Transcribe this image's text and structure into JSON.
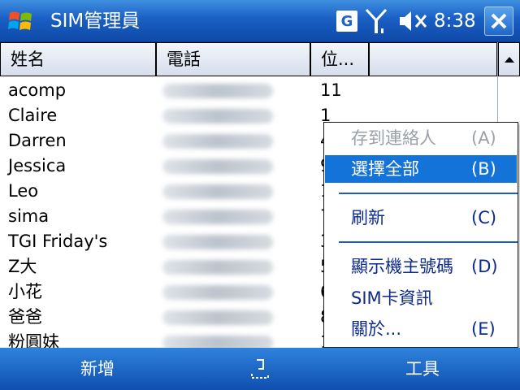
{
  "titlebar": {
    "title": "SIM管理員",
    "clock": "8:38",
    "g_label": "G"
  },
  "columns": {
    "name": "姓名",
    "phone": "電話",
    "location": "位...",
    "extra": ""
  },
  "rows": [
    {
      "name": "acomp",
      "loc": "11"
    },
    {
      "name": "Claire",
      "loc": "1"
    },
    {
      "name": "Darren",
      "loc": "4"
    },
    {
      "name": "Jessica",
      "loc": "9"
    },
    {
      "name": "Leo",
      "loc": "1"
    },
    {
      "name": "sima",
      "loc": "7"
    },
    {
      "name": "TGI Friday's",
      "loc": "3"
    },
    {
      "name": "Z大",
      "loc": "5"
    },
    {
      "name": "小花",
      "loc": "6"
    },
    {
      "name": "爸爸",
      "loc": "8"
    },
    {
      "name": "粉圓妹",
      "loc": "1"
    }
  ],
  "menu": {
    "save_contact": {
      "label": "存到連絡人",
      "key": "(A)"
    },
    "select_all": {
      "label": "選擇全部",
      "key": "(B)"
    },
    "refresh": {
      "label": "刷新",
      "key": "(C)"
    },
    "show_owner": {
      "label": "顯示機主號碼",
      "key": "(D)"
    },
    "sim_info": {
      "label": "SIM卡資訊",
      "key": ""
    },
    "about": {
      "label": "關於...",
      "key": "(E)"
    }
  },
  "softkeys": {
    "left": "新增",
    "right": "工具"
  },
  "colors": {
    "accent": "#1473d8",
    "titlebar": "#1a5fc4",
    "menu_text": "#0c2a8c",
    "disabled": "#9aa0a8"
  }
}
